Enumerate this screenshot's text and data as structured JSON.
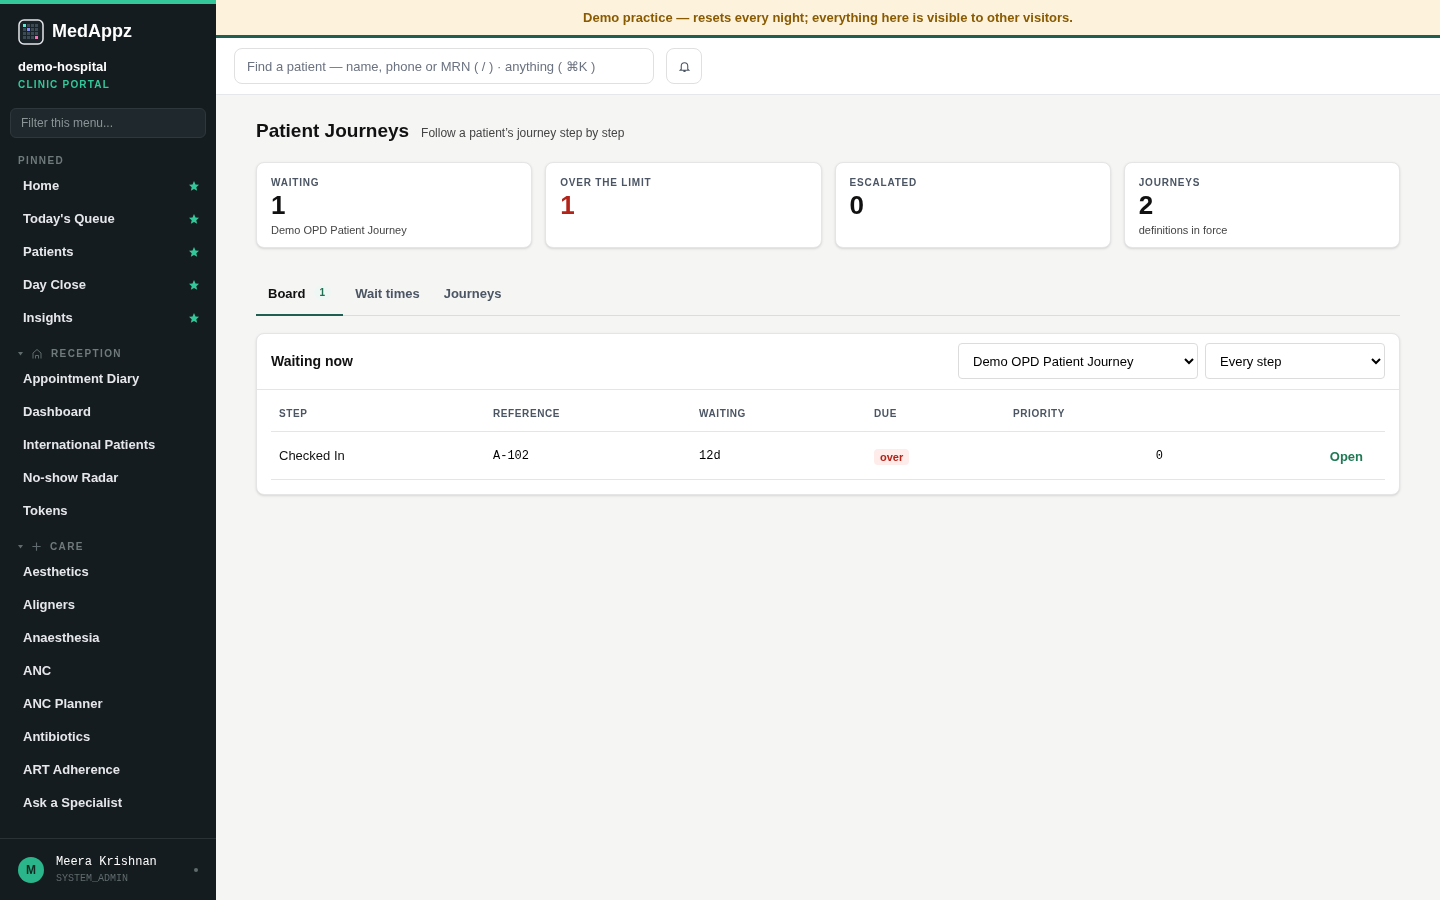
{
  "brand": {
    "name": "MedAppz",
    "org": "demo-hospital",
    "portal": "CLINIC PORTAL"
  },
  "sidebar": {
    "filter": {
      "placeholder": "Filter this menu..."
    },
    "sections": [
      {
        "label": "PINNED",
        "kind": "plain",
        "items": [
          {
            "label": "Home",
            "pinned": true
          },
          {
            "label": "Today's Queue",
            "pinned": true
          },
          {
            "label": "Patients",
            "pinned": true
          },
          {
            "label": "Day Close",
            "pinned": true
          },
          {
            "label": "Insights",
            "pinned": true
          }
        ]
      },
      {
        "label": "RECEPTION",
        "kind": "home",
        "expanded": true,
        "items": [
          {
            "label": "Appointment Diary",
            "pinned": false
          },
          {
            "label": "Dashboard",
            "pinned": false
          },
          {
            "label": "International Patients",
            "pinned": false
          },
          {
            "label": "No-show Radar",
            "pinned": false
          },
          {
            "label": "Tokens",
            "pinned": false
          }
        ]
      },
      {
        "label": "CARE",
        "kind": "plus",
        "expanded": true,
        "items": [
          {
            "label": "Aesthetics",
            "pinned": false
          },
          {
            "label": "Aligners",
            "pinned": false
          },
          {
            "label": "Anaesthesia",
            "pinned": false
          },
          {
            "label": "ANC",
            "pinned": false
          },
          {
            "label": "ANC Planner",
            "pinned": false
          },
          {
            "label": "Antibiotics",
            "pinned": false
          },
          {
            "label": "ART Adherence",
            "pinned": false
          },
          {
            "label": "Ask a Specialist",
            "pinned": false
          }
        ]
      }
    ],
    "user": {
      "initial": "M",
      "name": "Meera Krishnan",
      "role": "SYSTEM_ADMIN"
    }
  },
  "banner": "Demo practice — resets every night; everything here is visible to other visitors.",
  "search": {
    "placeholder": "Find a patient — name, phone or MRN ( / ) · anything ( ⌘K )"
  },
  "page": {
    "title": "Patient Journeys",
    "subtitle": "Follow a patient’s journey step by step"
  },
  "stats": [
    {
      "label": "WAITING",
      "value": "1",
      "note": "Demo OPD Patient Journey",
      "alert": false
    },
    {
      "label": "OVER THE LIMIT",
      "value": "1",
      "alert": true
    },
    {
      "label": "ESCALATED",
      "value": "0",
      "alert": false
    },
    {
      "label": "JOURNEYS",
      "value": "2",
      "note": "definitions in force",
      "alert": false
    }
  ],
  "tabs": [
    {
      "label": "Board",
      "count": "1",
      "selected": true
    },
    {
      "label": "Wait times",
      "selected": false
    },
    {
      "label": "Journeys",
      "selected": false
    }
  ],
  "panel": {
    "title": "Waiting now",
    "journey_select": "Demo OPD Patient Journey",
    "step_select": "Every step",
    "columns": [
      "STEP",
      "REFERENCE",
      "WAITING",
      "DUE",
      "PRIORITY"
    ],
    "rows": [
      {
        "step": "Checked In",
        "reference": "A-102",
        "waiting": "12d",
        "due": "over",
        "overdue": true,
        "priority": "0",
        "action": "Open"
      }
    ]
  }
}
